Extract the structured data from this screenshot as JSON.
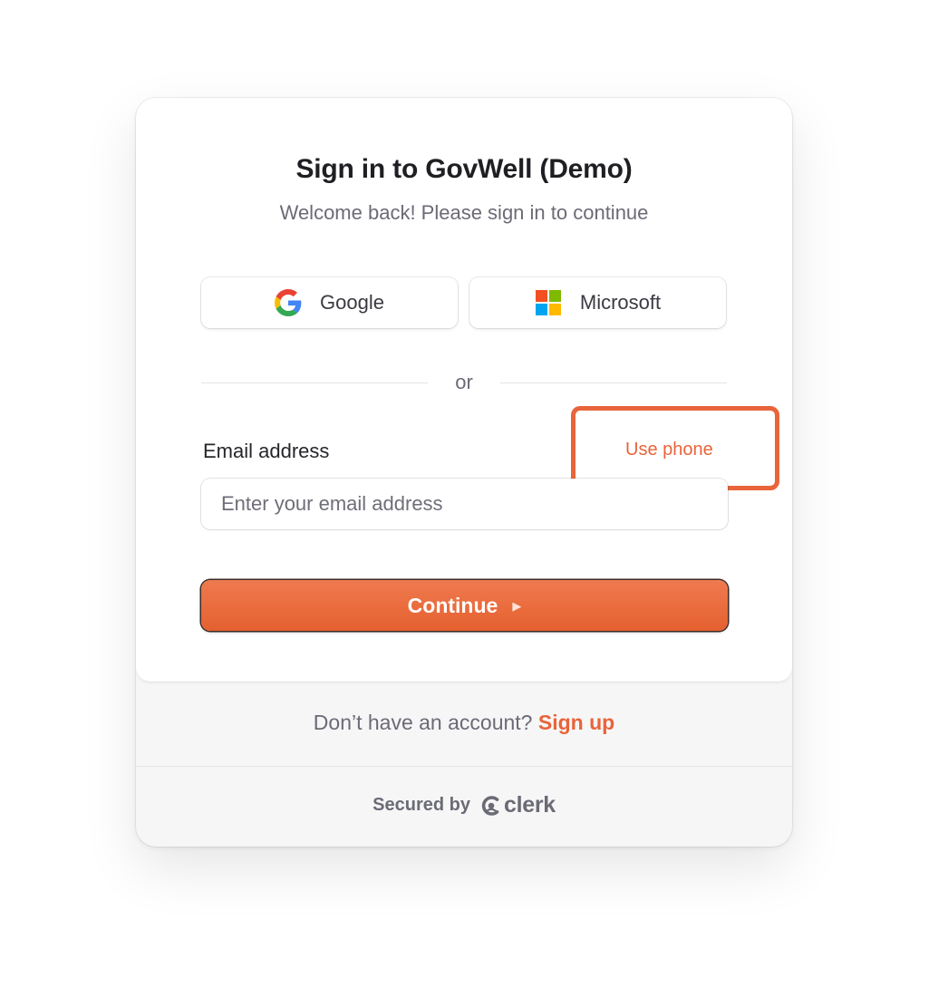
{
  "header": {
    "title": "Sign in to GovWell (Demo)",
    "subtitle": "Welcome back! Please sign in to continue"
  },
  "social": {
    "google": {
      "label": "Google",
      "icon": "google-icon"
    },
    "microsoft": {
      "label": "Microsoft",
      "icon": "microsoft-icon"
    }
  },
  "divider": {
    "text": "or"
  },
  "email": {
    "label": "Email address",
    "placeholder": "Enter your email address",
    "value": "",
    "alt_link": "Use phone"
  },
  "continue": {
    "label": "Continue",
    "icon": "play-arrow-icon"
  },
  "footer": {
    "prompt": "Don’t have an account?",
    "signup_label": "Sign up",
    "secured_by": "Secured by",
    "brand": "clerk"
  },
  "colors": {
    "accent": "#e8643a",
    "highlight_box": "#e8643a",
    "text_primary": "#1f1f23",
    "text_secondary": "#6b6b76"
  }
}
